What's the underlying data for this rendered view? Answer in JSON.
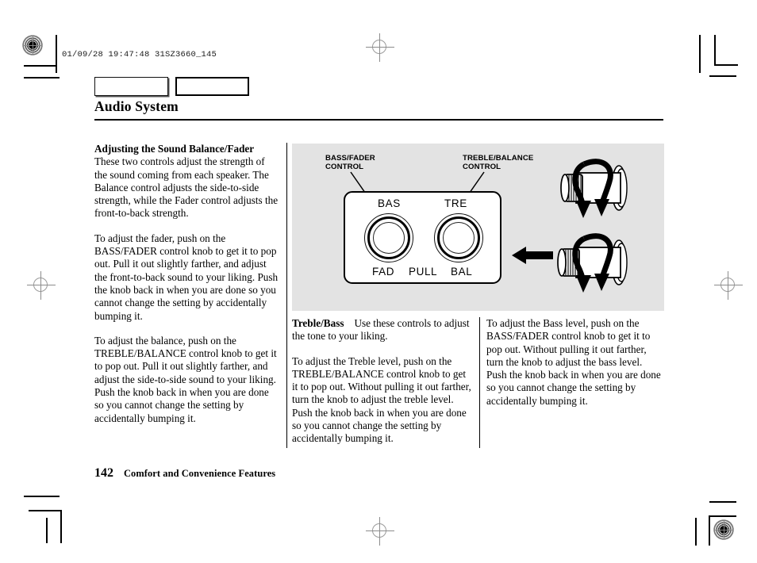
{
  "print_marks": {
    "header_code": "01/09/28 19:47:48 31SZ3660_145"
  },
  "tabs": [
    {
      "name": "tab-left",
      "label": ""
    },
    {
      "name": "tab-right",
      "label": ""
    }
  ],
  "header": {
    "title": "Audio System"
  },
  "content": {
    "left_column": {
      "p1_heading": "Adjusting the Sound Balance/Fader",
      "p1_body": "These two controls adjust the strength of the sound coming from each speaker. The Balance control adjusts the side-to-side strength, while the Fader control adjusts the front-to-back strength.",
      "p2": "To adjust the fader, push on the BASS/FADER control knob to get it to pop out. Pull it out slightly farther, and adjust the front-to-back sound to your liking. Push the knob back in when you are done so you cannot change the setting by accidentally bumping it.",
      "p3": "To adjust the balance, push on the TREBLE/BALANCE control knob to get it to pop out. Pull it out slightly farther, and adjust the side-to-side sound to your liking. Push the knob back in when you are done so you cannot change the setting by accidentally bumping it."
    },
    "middle_column": {
      "p1_heading": "Treble/Bass",
      "p1_body": "Use these controls to adjust the tone to your liking.",
      "p2": "To adjust the Treble level, push on the TREBLE/BALANCE control knob to get it to pop out. Without pulling it out farther, turn the knob to adjust the treble level. Push the knob back in when you are done so you cannot change the setting by accidentally bumping it."
    },
    "right_column": {
      "p1": "To adjust the Bass level, push on the BASS/FADER control knob to get it to pop out. Without pulling it out farther, turn the knob to adjust the bass level. Push the knob back in when you are done so you cannot change the setting by accidentally bumping it."
    }
  },
  "figure": {
    "background_color": "#e3e3e3",
    "callouts": {
      "bass_fader": "BASS/FADER\nCONTROL",
      "treble_balance": "TREBLE/BALANCE\nCONTROL"
    },
    "faceplate": {
      "bas": "BAS",
      "tre": "TRE",
      "fad": "FAD",
      "pull": "PULL",
      "bal": "BAL"
    }
  },
  "footer": {
    "page_number": "142",
    "section": "Comfort and Convenience Features"
  }
}
